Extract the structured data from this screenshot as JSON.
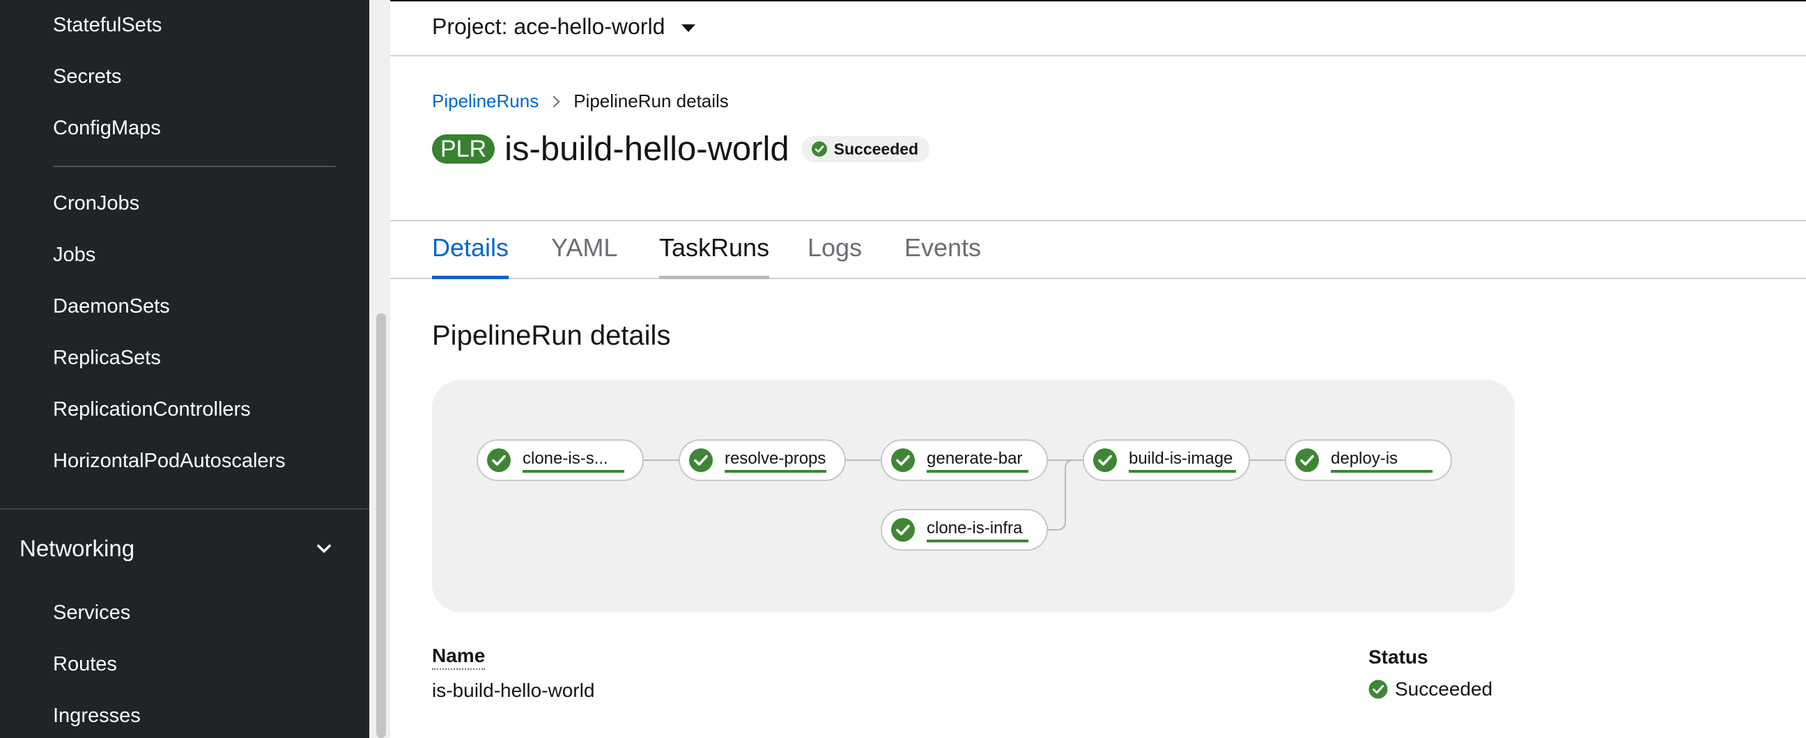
{
  "sidebar": {
    "workloads_items": [
      {
        "label": "StatefulSets"
      },
      {
        "label": "Secrets"
      },
      {
        "label": "ConfigMaps"
      },
      {
        "label": "CronJobs"
      },
      {
        "label": "Jobs"
      },
      {
        "label": "DaemonSets"
      },
      {
        "label": "ReplicaSets"
      },
      {
        "label": "ReplicationControllers"
      },
      {
        "label": "HorizontalPodAutoscalers"
      }
    ],
    "networking": {
      "label": "Networking",
      "items": [
        {
          "label": "Services"
        },
        {
          "label": "Routes"
        },
        {
          "label": "Ingresses"
        }
      ]
    }
  },
  "header": {
    "project_label": "Project: ace-hello-world"
  },
  "breadcrumb": {
    "parent": "PipelineRuns",
    "current": "PipelineRun details"
  },
  "page": {
    "badge": "PLR",
    "title": "is-build-hello-world",
    "status": "Succeeded"
  },
  "tabs": [
    {
      "label": "Details"
    },
    {
      "label": "YAML"
    },
    {
      "label": "TaskRuns"
    },
    {
      "label": "Logs"
    },
    {
      "label": "Events"
    }
  ],
  "details": {
    "section_title": "PipelineRun details",
    "tasks": [
      {
        "label": "clone-is-s..."
      },
      {
        "label": "resolve-props"
      },
      {
        "label": "generate-bar"
      },
      {
        "label": "build-is-image"
      },
      {
        "label": "deploy-is"
      },
      {
        "label": "clone-is-infra"
      }
    ],
    "name_label": "Name",
    "name_value": "is-build-hello-world",
    "status_label": "Status",
    "status_value": "Succeeded"
  },
  "colors": {
    "success": "#3e8635",
    "link": "#0066cc",
    "sidebar_bg": "#212427"
  }
}
